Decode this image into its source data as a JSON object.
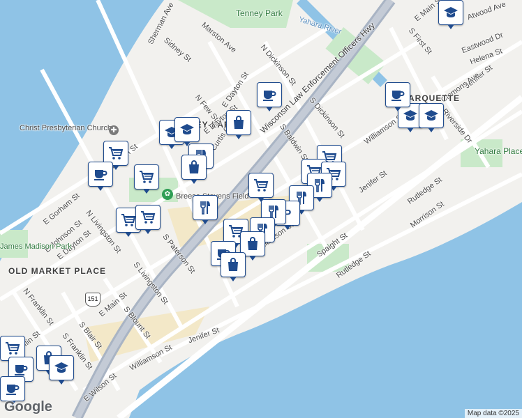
{
  "map": {
    "colors": {
      "water": "#8fc3e6",
      "land": "#f2f1ee",
      "park": "#c9e9c9",
      "road": "#ffffff",
      "highway": "#a9b4c4",
      "pin_border": "#1f4b8e",
      "beach": "#f3e8c8"
    },
    "labels": {
      "tenney_park": "Tenney Park",
      "yahara_river": "Yahara River",
      "christ_church": "Christ Presbyterian Church",
      "tenney_lapham": "TENNEY-LAPHAM",
      "marquette": "MARQUETTE",
      "yahara_place_park": "Yahara Place Park",
      "breese_stevens": "Breese Stevens Field",
      "old_market_place": "OLD MARKET PLACE",
      "james_madison_park": "James Madison Park",
      "hwy": "Wisconsin Law Enforcement Officers Hwy",
      "route_151": "151"
    },
    "streets": {
      "sherman_ave": "Sherman Ave",
      "sidney_st": "Sidney St",
      "marston_ave": "Marston Ave",
      "n_dickinson_st": "N Dickinson St",
      "e_dayton_st": "E Dayton St",
      "n_few_st": "N Few St",
      "curtis_ct": "Curtis Ct",
      "s_dickinson_st": "S Dickinson St",
      "s_baldwin_st": "S Baldwin St",
      "williamson_st": "Williamson St",
      "jenifer_st": "Jenifer St",
      "rutledge_st": "Rutledge St",
      "morrison_st": "Morrison St",
      "spaight_st": "Spaight St",
      "s_first_st": "S First St",
      "e_main_st": "E Main St",
      "atwood_ave": "Atwood Ave",
      "eastwood_dr": "Eastwood Dr",
      "helena_st": "Helena St",
      "clemons_ave": "Clemons Ave",
      "riverside_dr": "Riverside Dr",
      "e_gorham_st": "E Gorham St",
      "e_johnson_st": "E Johnson St",
      "n_livingston_st": "N Livingston St",
      "n_franklin_st": "N Franklin St",
      "s_paterson_st": "S Paterson St",
      "s_livingston_st": "S Livingston St",
      "e_main_st_2": "E Main St",
      "s_blount_st": "S Blount St",
      "s_blair_st": "S Blair St",
      "s_franklin_st": "S Franklin St",
      "e_wilson_st": "E Wilson St",
      "mifflin_st": "Mifflin St",
      "johnson_st_frag": "Johnson St"
    },
    "attribution": "Map data ©2025",
    "logo": "Google"
  }
}
